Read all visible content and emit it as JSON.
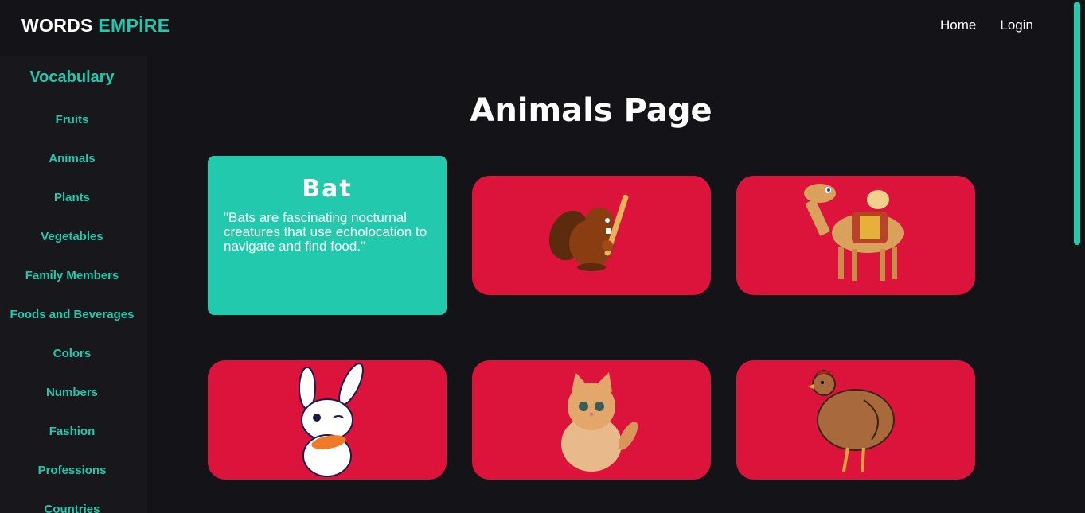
{
  "header": {
    "logo_word1": "WORDS",
    "logo_word2": "EMPİRE",
    "nav": [
      "Home",
      "Login"
    ]
  },
  "sidebar": {
    "title": "Vocabulary",
    "items": [
      "Fruits",
      "Animals",
      "Plants",
      "Vegetables",
      "Family Members",
      "Foods and Beverages",
      "Colors",
      "Numbers",
      "Fashion",
      "Professions",
      "Countries"
    ]
  },
  "main": {
    "title": "Animals Page",
    "info_card": {
      "name": "Bat",
      "description": "\"Bats are fascinating nocturnal creatures that use echolocation to navigate and find food.\""
    },
    "cards": [
      {
        "icon": "beaver-icon"
      },
      {
        "icon": "camel-icon"
      },
      {
        "icon": "rabbit-icon"
      },
      {
        "icon": "kitten-icon"
      },
      {
        "icon": "hen-icon"
      }
    ]
  },
  "colors": {
    "accent": "#22c9ad",
    "card": "#dc143c",
    "background": "#141318"
  }
}
